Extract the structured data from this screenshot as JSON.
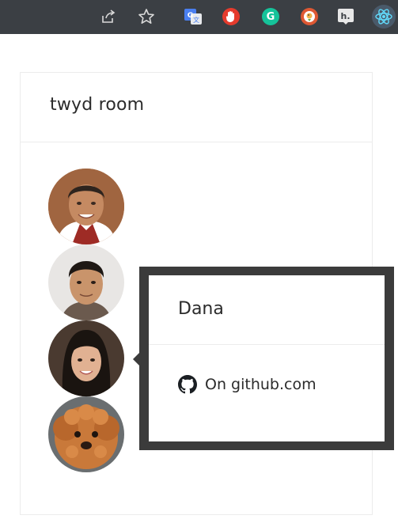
{
  "browser_toolbar": {
    "background": "#3b3f44",
    "icons": [
      "share-icon",
      "star-icon",
      "google-translate-icon",
      "hand-stop-icon",
      "grammarly-icon",
      "duckduckgo-icon",
      "hypothesis-icon",
      "react-devtools-icon"
    ],
    "ext_letters": {
      "translate": "G",
      "grammarly": "G",
      "hypothesis": "h."
    }
  },
  "room": {
    "title": "twyd room",
    "members": [
      {
        "kind": "person",
        "icon": "avatar-man-1"
      },
      {
        "kind": "person",
        "icon": "avatar-man-2"
      },
      {
        "kind": "person",
        "icon": "avatar-woman"
      },
      {
        "kind": "dog",
        "icon": "avatar-dog"
      }
    ]
  },
  "popover": {
    "name": "Dana",
    "link_label": "On github.com",
    "link_icon": "github-icon",
    "frame_color": "#3b3b3b"
  }
}
